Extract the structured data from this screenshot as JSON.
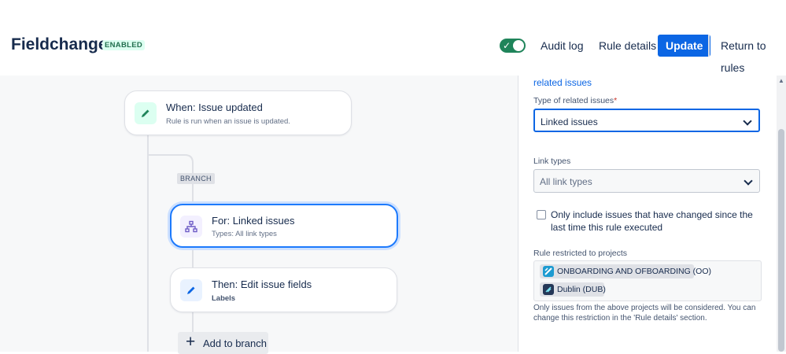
{
  "header": {
    "title": "Fieldchange",
    "status_badge": "ENABLED",
    "audit_log": "Audit log",
    "rule_details": "Rule details",
    "update": "Update",
    "return_to_rules": "Return to rules"
  },
  "canvas": {
    "trigger": {
      "title": "When: Issue updated",
      "subtitle": "Rule is run when an issue is updated."
    },
    "branch_tag": "BRANCH",
    "branch": {
      "title": "For: Linked issues",
      "subtitle": "Types: All link types"
    },
    "action": {
      "title": "Then: Edit issue fields",
      "subtitle": "Labels"
    },
    "add_branch": "Add to branch"
  },
  "panel": {
    "top_link": "related issues",
    "type_label": "Type of related issues",
    "type_required": "*",
    "type_value": "Linked issues",
    "link_types_label": "Link types",
    "link_types_placeholder": "All link types",
    "checkbox_label": "Only include issues that have changed since the last time this rule executed",
    "projects_label": "Rule restricted to projects",
    "projects": [
      {
        "name": "ONBOARDING AND OFBOARDING (OO)"
      },
      {
        "name": "Dublin (DUB)"
      }
    ],
    "help_text": "Only issues from the above projects will be considered. You can change this restriction in the 'Rule details' section."
  },
  "colors": {
    "primary": "#0c66e4",
    "enabled_toggle": "#1f845a",
    "badge_text": "#216e4e",
    "selected_border": "#1d7afc"
  }
}
